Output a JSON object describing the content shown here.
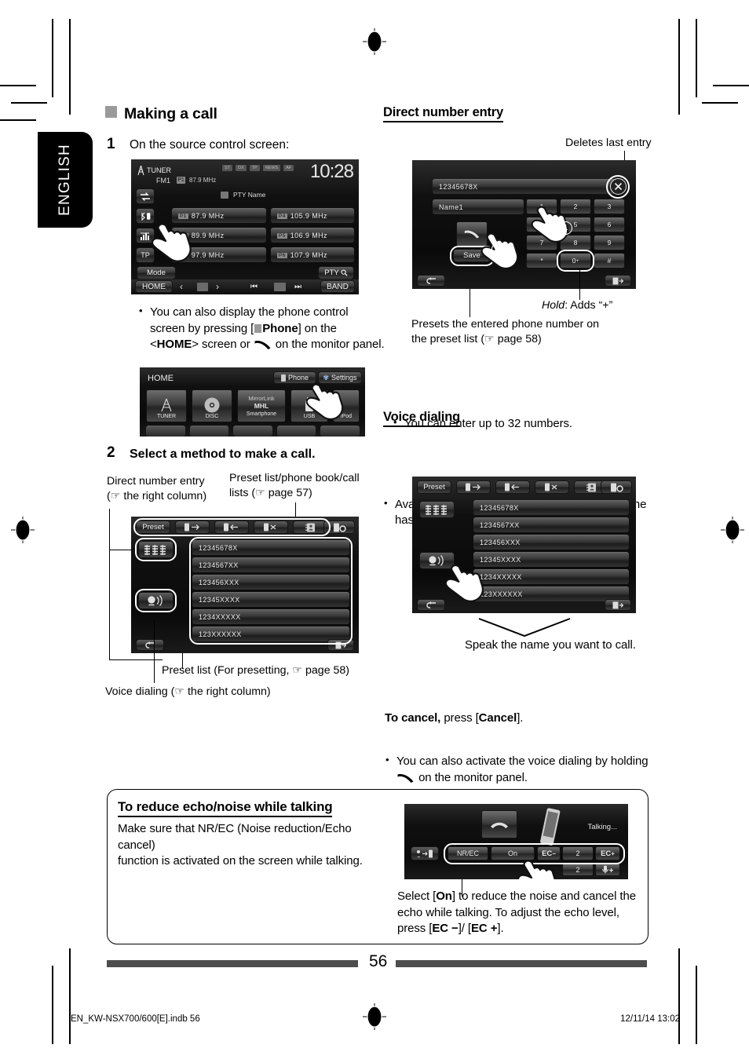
{
  "page": {
    "language_tab": "ENGLISH",
    "number": "56",
    "footer_left": "EN_KW-NSX700/600[E].indb   56",
    "footer_right": "12/11/14   13:02"
  },
  "left_column": {
    "section_title": "Making a call",
    "step1": {
      "number": "1",
      "text": "On the source control screen:"
    },
    "note1": {
      "part1": "You can also display the phone control screen by pressing [",
      "phone_label": "Phone",
      "part2": "] on the <",
      "home_label": "HOME",
      "part3": "> screen or ",
      "part4": " on the monitor panel."
    },
    "step2": {
      "number": "2",
      "text": "Select a method to make a call."
    },
    "callouts": {
      "direct_entry": "Direct number entry\n(☞ the right column)",
      "direct_entry_l1": "Direct number entry",
      "direct_entry_l2": "(☞ the right column)",
      "preset_list_l1": "Preset list/phone book/call",
      "preset_list_l2": "lists (☞ page 57)",
      "preset_list_bottom": "Preset list (For presetting, ☞ page 58)",
      "voice_dialing": "Voice dialing (☞ the right column)"
    },
    "tuner_screen": {
      "source": "TUNER",
      "band": "FM1",
      "preset_tag": "P1",
      "freq_now": "87.9 MHz",
      "clock": "10:28",
      "indicators": [
        "ST",
        "DX",
        "TP",
        "NEWS",
        "AF"
      ],
      "pty_name": "PTY Name",
      "left_labels": [
        "TP"
      ],
      "presets_left": [
        "87.9 MHz",
        "89.9 MHz",
        "97.9 MHz"
      ],
      "presets_left_tags": [
        "P1",
        "P2",
        "P3"
      ],
      "presets_right": [
        "105.9 MHz",
        "106.9 MHz",
        "107.9 MHz"
      ],
      "presets_right_tags": [
        "P4",
        "P5",
        "P6"
      ],
      "mode": "Mode",
      "pty": "PTY",
      "home": "HOME",
      "band_btn": "BAND"
    },
    "home_screen": {
      "title": "HOME",
      "phone": "Phone",
      "settings": "Settings",
      "sources": [
        "TUNER",
        "DISC",
        "Smartphone",
        "USB",
        "iPod"
      ],
      "mirrorlink": "MirrorLink",
      "mhl": "MHL"
    },
    "phone_screen": {
      "preset": "Preset",
      "list": [
        "12345678X",
        "1234567XX",
        "123456XXX",
        "12345XXXX",
        "1234XXXXX",
        "123XXXXXX"
      ]
    }
  },
  "right_column": {
    "direct_entry": {
      "heading": "Direct number entry",
      "deletes_last": "Deletes last entry",
      "hold_adds": "Hold: Adds “+”",
      "hold_word": "Hold",
      "hold_rest": ": Adds “+”",
      "presets_note_l1": "Presets the entered phone number on",
      "presets_note_l2": "the preset list (☞ page 58)",
      "bullet_32": "You can enter up to 32 numbers.",
      "screen": {
        "number_field": "12345678X",
        "name_field": "Name1",
        "save": "Save",
        "keys": [
          "1",
          "2",
          "3",
          "4",
          "5",
          "6",
          "7",
          "8",
          "9",
          "*",
          "0+",
          "#"
        ],
        "zero_key": "0",
        "zero_sub": "+",
        "bubble1": "1",
        "bubble2": "2"
      }
    },
    "voice_dialing": {
      "heading": "Voice dialing",
      "bullet1": "Available only when the connected mobile phone has the voice recognition system.",
      "speak": "Speak the name you want to call.",
      "bullet2_a": "You can also activate the voice dialing by holding ",
      "bullet2_b": " on the monitor panel.",
      "cancel_a": "To cancel,",
      "cancel_b": " press [",
      "cancel_c": "Cancel",
      "cancel_d": "].",
      "screen": {
        "preset": "Preset",
        "list": [
          "12345678X",
          "1234567XX",
          "123456XXX",
          "12345XXXX",
          "1234XXXXX",
          "123XXXXXX"
        ]
      }
    }
  },
  "tip_box": {
    "heading": "To reduce echo/noise while talking",
    "text_l1": "Make sure that NR/EC (Noise reduction/Echo cancel)",
    "text_l2": "function is activated on the screen while talking.",
    "caption_l1_a": "Select [",
    "caption_on": "On",
    "caption_l1_b": "] to reduce the noise and cancel the echo",
    "caption_l2_a": "while talking. To adjust the echo level, press [",
    "caption_ec_minus": "EC −",
    "caption_l2_b": "]/",
    "caption_l3_a": "[",
    "caption_ec_plus": "EC +",
    "caption_l3_b": "].",
    "screen": {
      "status": "Talking...",
      "nrec": "NR/EC",
      "on": "On",
      "ec_minus": "EC",
      "ec_minus_sub": "−",
      "ec_value": "2",
      "ec_plus": "EC",
      "ec_plus_sub": "+",
      "mic_value": "2"
    }
  },
  "colors": {
    "accent_gray": "#9a9a9a",
    "screen_dark": "#0b0b0b",
    "footer_bar": "#4d4d4d"
  }
}
